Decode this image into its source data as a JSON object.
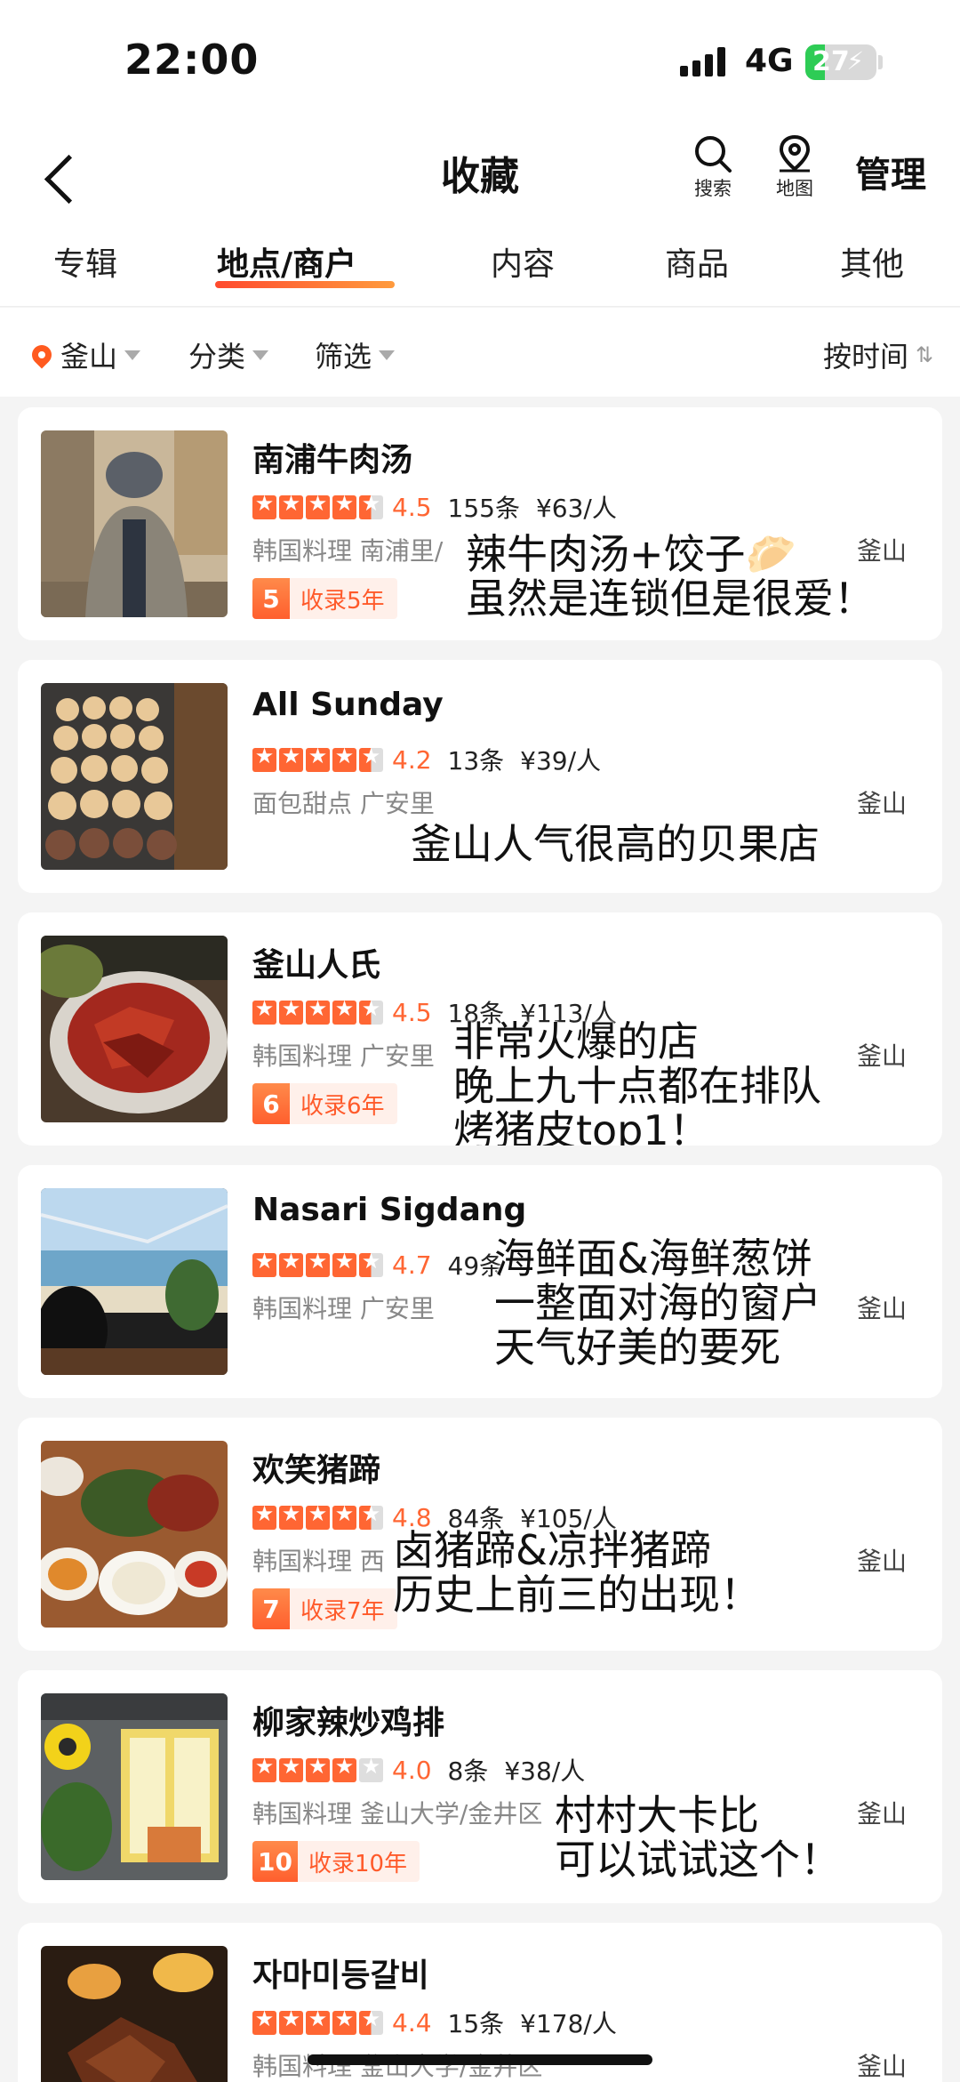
{
  "status": {
    "time": "22:00",
    "network": "4G",
    "battery": "27",
    "battery_level": 0.27
  },
  "nav": {
    "title": "收藏",
    "search_label": "搜索",
    "map_label": "地图",
    "manage_label": "管理"
  },
  "tabs": [
    {
      "label": "专辑"
    },
    {
      "label": "地点/商户"
    },
    {
      "label": "内容"
    },
    {
      "label": "商品"
    },
    {
      "label": "其他"
    }
  ],
  "active_tab": "地点/商户",
  "filters": {
    "city": "釜山",
    "category": "分类",
    "filter": "筛选",
    "sort": "按时间"
  },
  "accent_color": "#ff6633",
  "places": [
    {
      "name": "南浦牛肉汤",
      "rating": 4.5,
      "score": "4.5",
      "reviews": "155条",
      "price": "¥63/人",
      "category": "韩国料理 南浦里/",
      "city": "釜山",
      "badge_num": "5",
      "badge_text": "收录5年",
      "note_lines": [
        "辣牛肉汤+饺子🥟",
        "虽然是连锁但是很爱！"
      ],
      "image": "person-icon"
    },
    {
      "name": "All Sunday",
      "rating": 4.2,
      "score": "4.2",
      "reviews": "13条",
      "price": "¥39/人",
      "category": "面包甜点 广安里",
      "city": "釜山",
      "badge_num": "",
      "badge_text": "",
      "note_lines": [
        "釜山人气很高的贝果店"
      ],
      "image": "bagel-tray-icon"
    },
    {
      "name": "釜山人氏",
      "rating": 4.5,
      "score": "4.5",
      "reviews": "18条",
      "price": "¥113/人",
      "category": "韩国料理 广安里",
      "city": "釜山",
      "badge_num": "6",
      "badge_text": "收录6年",
      "note_lines": [
        "非常火爆的店",
        "晚上九十点都在排队",
        "烤猪皮top1！"
      ],
      "image": "grilled-dish-icon"
    },
    {
      "name": "Nasari Sigdang",
      "rating": 4.7,
      "score": "4.7",
      "reviews": "49条",
      "price": "",
      "category": "韩国料理 广安里",
      "city": "釜山",
      "badge_num": "",
      "badge_text": "",
      "note_lines": [
        "海鲜面&海鲜葱饼",
        "一整面对海的窗户",
        "天气好美的要死"
      ],
      "image": "sea-view-icon"
    },
    {
      "name": "欢笑猪蹄",
      "rating": 4.8,
      "score": "4.8",
      "reviews": "84条",
      "price": "¥105/人",
      "category": "韩国料理 西",
      "city": "釜山",
      "badge_num": "7",
      "badge_text": "收录7年",
      "note_lines": [
        "卤猪蹄&凉拌猪蹄",
        "历史上前三的出现！"
      ],
      "image": "food-table-icon"
    },
    {
      "name": "柳家辣炒鸡排",
      "rating": 4.0,
      "score": "4.0",
      "reviews": "8条",
      "price": "¥38/人",
      "category": "韩国料理 釜山大学/金井区",
      "city": "釜山",
      "badge_num": "10",
      "badge_text": "收录10年",
      "note_lines": [
        "村村大卡比",
        "可以试试这个！"
      ],
      "image": "storefront-icon"
    },
    {
      "name": "자마미등갈비",
      "rating": 4.4,
      "score": "4.4",
      "reviews": "15条",
      "price": "¥178/人",
      "category": "韩国料理 釜山大学/金井区",
      "city": "釜山",
      "badge_num": "",
      "badge_text": "",
      "note_lines": [],
      "image": "ribs-icon"
    }
  ]
}
